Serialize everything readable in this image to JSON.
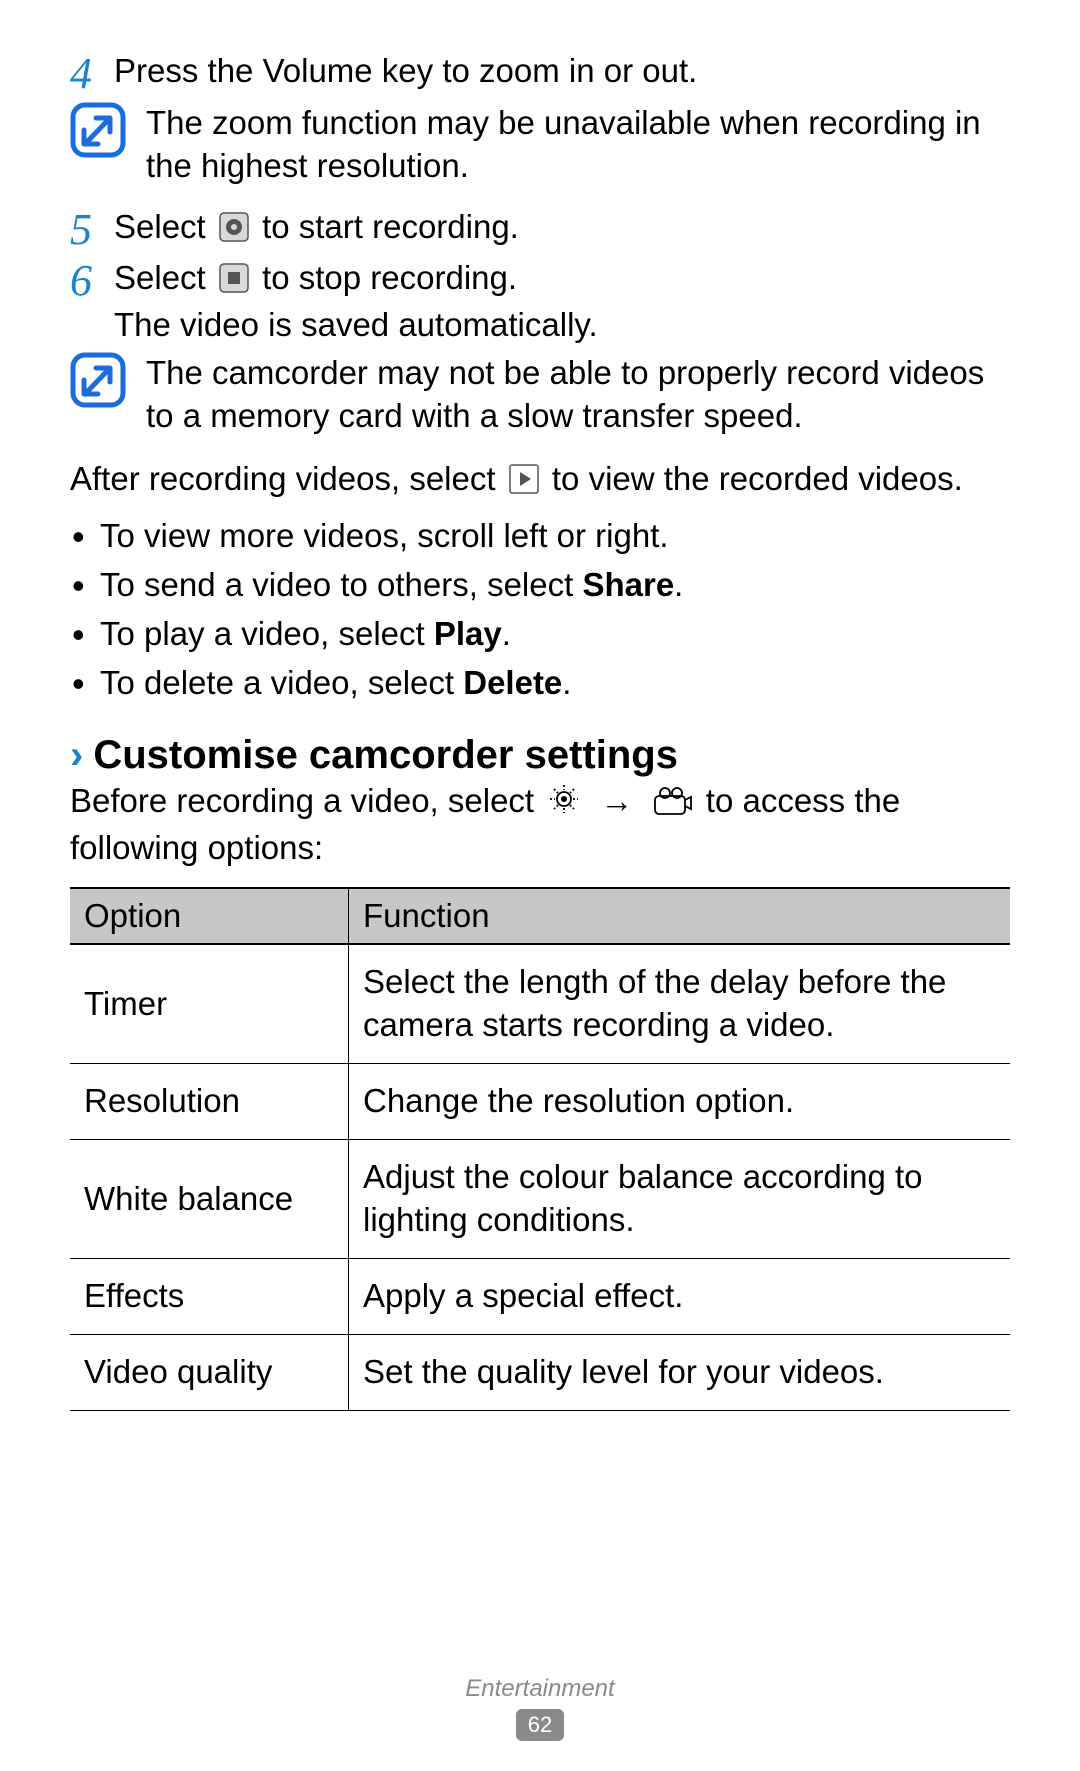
{
  "steps": {
    "s4": {
      "num": "4",
      "text": "Press the Volume key to zoom in or out."
    },
    "s5": {
      "num": "5",
      "pre": "Select ",
      "post": " to start recording."
    },
    "s6": {
      "num": "6",
      "pre": "Select ",
      "post": " to stop recording.",
      "extra": "The video is saved automatically."
    }
  },
  "notes": {
    "n1": "The zoom function may be unavailable when recording in the highest resolution.",
    "n2": "The camcorder may not be able to properly record videos to a memory card with a slow transfer speed."
  },
  "after": {
    "pre": "After recording videos, select ",
    "post": " to view the recorded videos."
  },
  "bullets": {
    "b1": "To view more videos, scroll left or right.",
    "b2_pre": "To send a video to others, select ",
    "b2_bold": "Share",
    "b2_post": ".",
    "b3_pre": "To play a video, select ",
    "b3_bold": "Play",
    "b3_post": ".",
    "b4_pre": "To delete a video, select ",
    "b4_bold": "Delete",
    "b4_post": "."
  },
  "section": {
    "title": "Customise camcorder settings",
    "pre": "Before recording a video, select ",
    "arrow": "→",
    "post": " to access the following options:"
  },
  "table": {
    "h1": "Option",
    "h2": "Function",
    "rows": [
      {
        "opt": "Timer",
        "fn": "Select the length of the delay before the camera starts recording a video."
      },
      {
        "opt": "Resolution",
        "fn": "Change the resolution option."
      },
      {
        "opt": "White balance",
        "fn": "Adjust the colour balance according to lighting conditions."
      },
      {
        "opt": "Effects",
        "fn": "Apply a special effect."
      },
      {
        "opt": "Video quality",
        "fn": "Set the quality level for your videos."
      }
    ]
  },
  "footer": {
    "section": "Entertainment",
    "page": "62"
  }
}
